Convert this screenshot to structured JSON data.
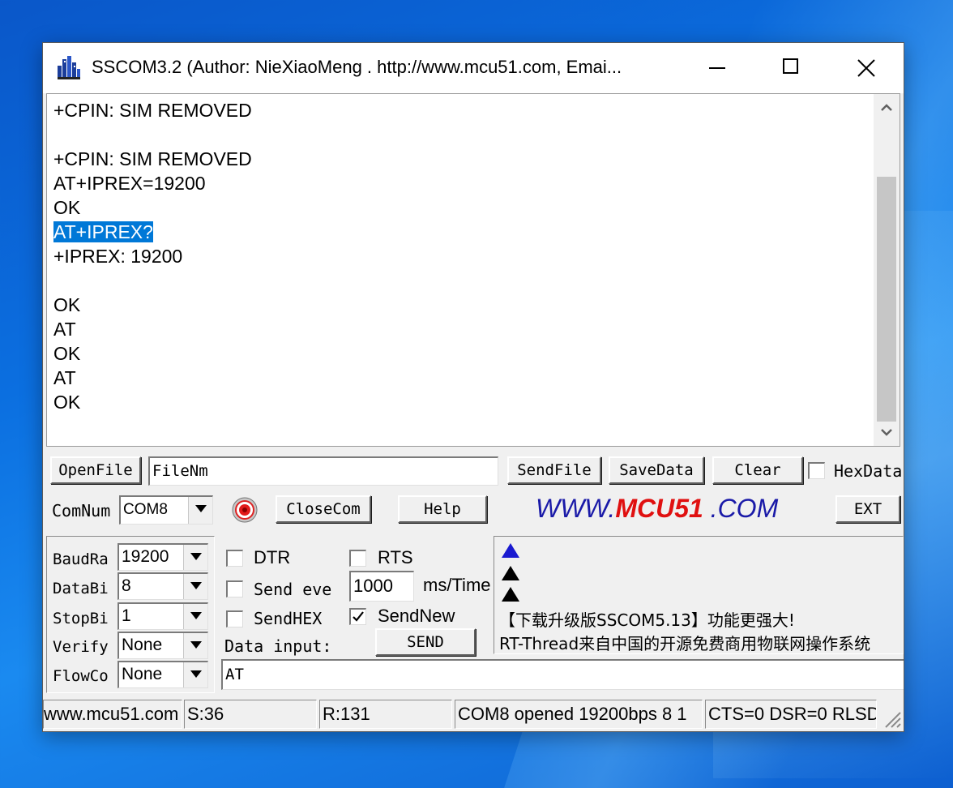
{
  "window": {
    "title": "SSCOM3.2 (Author: NieXiaoMeng .  http://www.mcu51.com,  Emai..."
  },
  "receive": {
    "lines": [
      "+CPIN: SIM REMOVED",
      "",
      "+CPIN: SIM REMOVED",
      "AT+IPREX=19200",
      "OK",
      "AT+IPREX?",
      "+IPREX: 19200",
      "",
      "OK",
      "AT",
      "OK",
      "AT",
      "OK"
    ],
    "selected_line_index": 5
  },
  "row1": {
    "openfile": "OpenFile",
    "filename": "FileNm",
    "sendfile": "SendFile",
    "savedata": "SaveData",
    "clear": "Clear",
    "hexdata": "HexData"
  },
  "row2": {
    "comnum_label": "ComNum",
    "comnum_value": "COM8",
    "closecom": "CloseCom",
    "help": "Help",
    "logo_www": "WWW.",
    "logo_mcu": "MCU51",
    "logo_com": " .COM",
    "ext": "EXT"
  },
  "settings": {
    "baud_label": "BaudRa",
    "baud_value": "19200",
    "databits_label": "DataBi",
    "databits_value": "8",
    "stopbits_label": "StopBi",
    "stopbits_value": "1",
    "verify_label": "Verify",
    "verify_value": "None",
    "flow_label": "FlowCo",
    "flow_value": "None"
  },
  "send": {
    "dtr": "DTR",
    "rts": "RTS",
    "send_every": "Send eve",
    "interval": "1000",
    "ms_time": "ms/Time",
    "sendhex": "SendHEX",
    "sendnew": "SendNew",
    "sendnew_checked": true,
    "data_input_label": "Data input:",
    "send_button": "SEND",
    "data_input_value": "AT"
  },
  "info": {
    "line1": "【下载升级版SSCOM5.13】功能更强大!",
    "line2": "RT-Thread来自中国的开源免费商用物联网操作系统"
  },
  "status": {
    "site": "www.mcu51.com",
    "sent": "S:36",
    "received": "R:131",
    "port": "COM8 opened 19200bps  8 1",
    "signals": "CTS=0 DSR=0 RLSD"
  },
  "colors": {
    "selection": "#0078d7",
    "logo_blue": "#1a1aa8",
    "logo_red": "#e01010",
    "arrow_blue": "#1a1ad0"
  }
}
